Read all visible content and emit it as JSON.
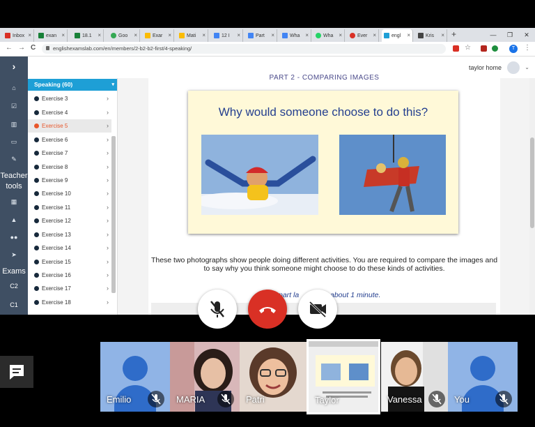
{
  "browser": {
    "tabs": [
      {
        "label": "Inbox",
        "color": "#d93025"
      },
      {
        "label": "exan",
        "color": "#188038"
      },
      {
        "label": "18.1",
        "color": "#188038"
      },
      {
        "label": "Goo",
        "color": "#34a853"
      },
      {
        "label": "Exar",
        "color": "#fbbc04"
      },
      {
        "label": "Mati",
        "color": "#fbbc04"
      },
      {
        "label": "12 I",
        "color": "#4285f4"
      },
      {
        "label": "Part",
        "color": "#4285f4"
      },
      {
        "label": "Wha",
        "color": "#4285f4"
      },
      {
        "label": "Wha",
        "color": "#25d366"
      },
      {
        "label": "Ever",
        "color": "#d93025"
      },
      {
        "label": "engl",
        "color": "#1e9fd6"
      },
      {
        "label": "Kris",
        "color": "#444444"
      }
    ],
    "new_tab": "+",
    "url": "englishexamslab.com/en/members/2-b2-b2-first/4-speaking/",
    "back": "←",
    "forward": "→",
    "reload": "C",
    "account_letter": "T"
  },
  "site": {
    "user_name": "taylor home",
    "leftbar": {
      "expand": "›",
      "teacher_tools": "Teacher tools",
      "exams": "Exams",
      "c2": "C2",
      "c1": "C1"
    },
    "section_title": "Speaking (60)",
    "exercises": [
      "Exercise 3",
      "Exercise 4",
      "Exercise 5",
      "Exercise 6",
      "Exercise 7",
      "Exercise 8",
      "Exercise 9",
      "Exercise 10",
      "Exercise 11",
      "Exercise 12",
      "Exercise 13",
      "Exercise 14",
      "Exercise 15",
      "Exercise 16",
      "Exercise 17",
      "Exercise 18"
    ],
    "active_exercise": "Exercise 5",
    "part_title": "PART 2 - COMPARING IMAGES",
    "question": "Why would someone choose to do this?",
    "description": "These two photographs show people doing different activities. You are required to compare the images and to say why you think someone might choose to do these kinds of activities.",
    "note_left": "part la",
    "note_right": "about 1 minute."
  },
  "meet": {
    "participants": [
      {
        "name": "Emilio",
        "type": "avatar",
        "muted": true
      },
      {
        "name": "MARIA",
        "type": "video",
        "muted": true
      },
      {
        "name": "Patri",
        "type": "video",
        "muted": false
      },
      {
        "name": "Taylor",
        "type": "screen",
        "muted": false
      },
      {
        "name": "Vanessa",
        "type": "video",
        "muted": true
      },
      {
        "name": "You",
        "type": "avatar",
        "muted": true
      }
    ]
  },
  "colors": {
    "accent": "#1e9fd6",
    "active_item": "#e8562a",
    "end_call": "#d93025",
    "sidebar": "#3f4f63"
  }
}
